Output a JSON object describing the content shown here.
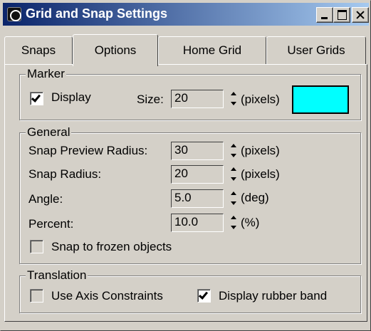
{
  "window": {
    "title": "Grid and Snap Settings",
    "title_bar_gradient": [
      "#0a246a",
      "#a6caf0"
    ],
    "buttons": [
      "minimize-icon",
      "maximize-icon",
      "close-icon"
    ]
  },
  "tabs": [
    {
      "label": "Snaps",
      "selected": false
    },
    {
      "label": "Options",
      "selected": true
    },
    {
      "label": "Home Grid",
      "selected": false
    },
    {
      "label": "User Grids",
      "selected": false
    }
  ],
  "marker": {
    "legend": "Marker",
    "display_label": "Display",
    "display_checked": true,
    "size_label": "Size:",
    "size_value": "20",
    "size_unit": "(pixels)",
    "color": "#00ffff"
  },
  "general": {
    "legend": "General",
    "snap_preview_radius_label": "Snap Preview Radius:",
    "snap_preview_radius_value": "30",
    "snap_preview_radius_unit": "(pixels)",
    "snap_radius_label": "Snap Radius:",
    "snap_radius_value": "20",
    "snap_radius_unit": "(pixels)",
    "angle_label": "Angle:",
    "angle_value": "5.0",
    "angle_unit": "(deg)",
    "percent_label": "Percent:",
    "percent_value": "10.0",
    "percent_unit": "(%)",
    "snap_frozen_label": "Snap to frozen objects",
    "snap_frozen_checked": false
  },
  "translation": {
    "legend": "Translation",
    "use_axis_label": "Use Axis Constraints",
    "use_axis_checked": false,
    "rubber_band_label": "Display rubber band",
    "rubber_band_checked": true
  }
}
